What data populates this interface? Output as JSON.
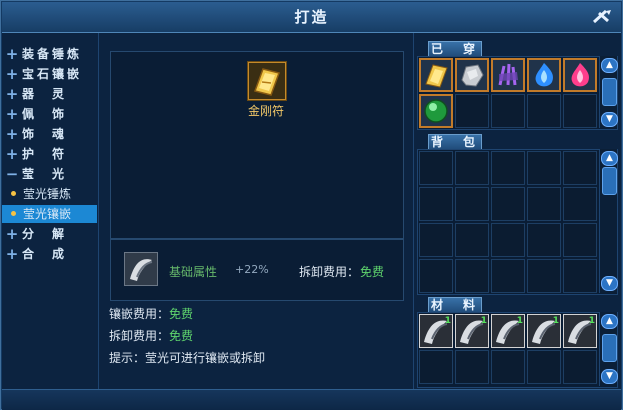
{
  "window": {
    "title": "打造"
  },
  "sidebar": {
    "items": [
      {
        "label": "装备锤炼",
        "sign": "+"
      },
      {
        "label": "宝石镶嵌",
        "sign": "+"
      },
      {
        "label": "器　灵",
        "sign": "+"
      },
      {
        "label": "佩　饰",
        "sign": "+"
      },
      {
        "label": "饰　魂",
        "sign": "+"
      },
      {
        "label": "护　符",
        "sign": "+"
      },
      {
        "label": "莹　光",
        "sign": "−"
      },
      {
        "label": "莹光锤炼",
        "sign": ""
      },
      {
        "label": "莹光镶嵌",
        "sign": ""
      },
      {
        "label": "分　解",
        "sign": "+"
      },
      {
        "label": "合　成",
        "sign": "+"
      }
    ],
    "selected": "莹光镶嵌"
  },
  "main": {
    "slot_item_label": "金刚符",
    "attribute": {
      "name": "基础属性",
      "value": "+22%",
      "remove_label": "拆卸费用：",
      "remove_value": "免费"
    },
    "inlay_cost_label": "镶嵌费用：",
    "inlay_cost_value": "免费",
    "remove_cost_label": "拆卸费用：",
    "remove_cost_value": "免费",
    "hint": "提示：莹光可进行镶嵌或拆卸"
  },
  "panels": {
    "inlaid": {
      "tab": "已　穿"
    },
    "bag": {
      "tab": "背　包"
    },
    "materials": {
      "tab": "材　料",
      "counts": [
        "1",
        "1",
        "1",
        "1",
        "1"
      ]
    }
  },
  "colors": {
    "accent": "#1c88d4",
    "free": "#5fd46d",
    "item_label": "#f3c868"
  }
}
